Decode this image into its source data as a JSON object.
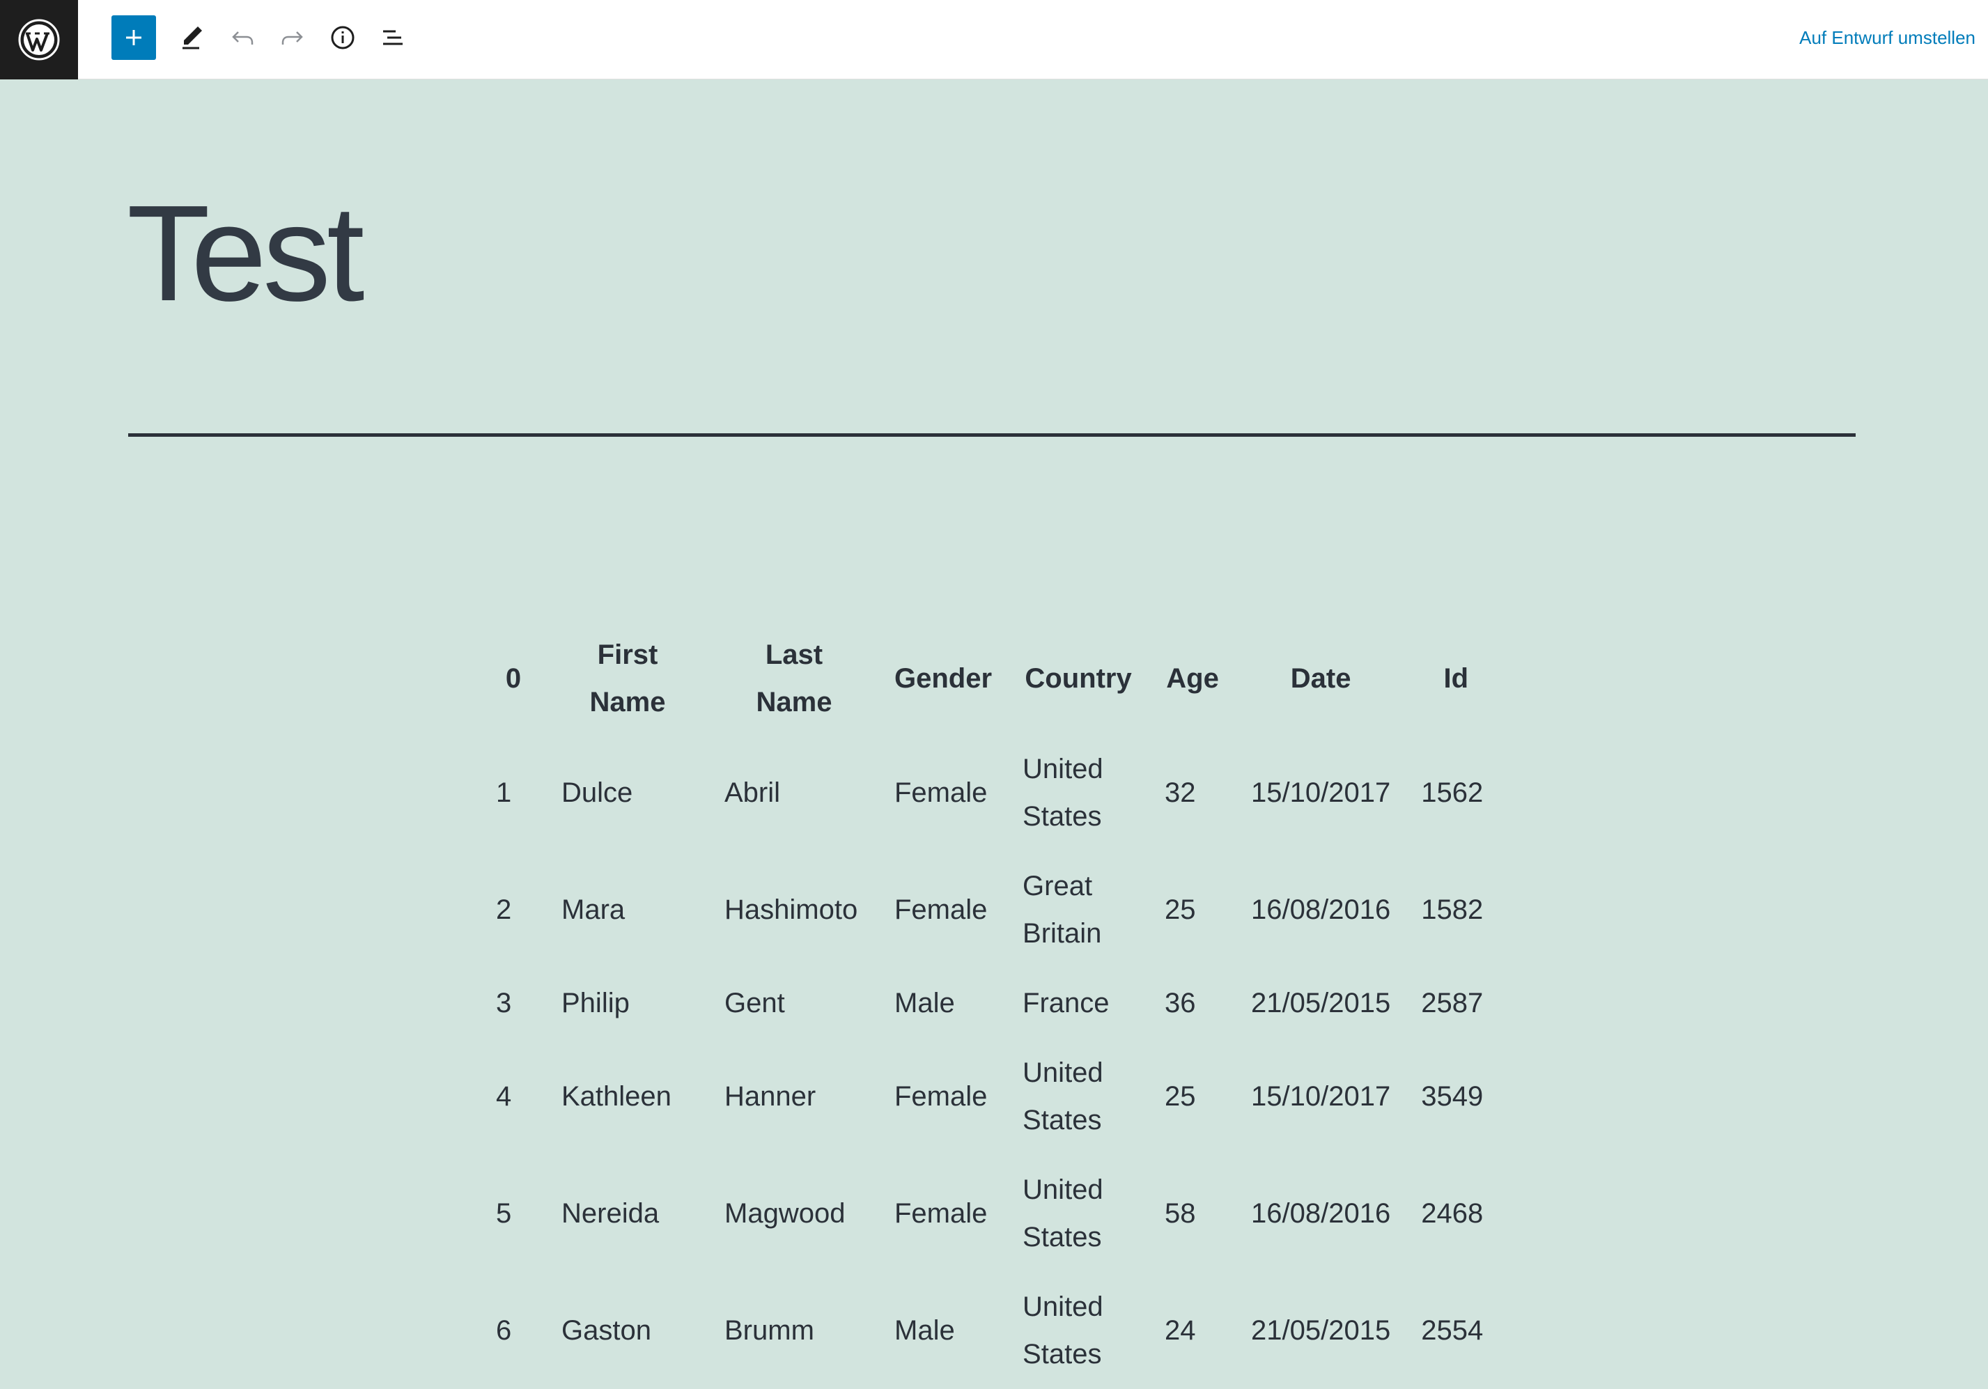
{
  "toolbar": {
    "logo_icon": "wordpress-icon",
    "add_icon": "plus-icon",
    "edit_icon": "pencil-icon",
    "undo_icon": "undo-icon",
    "redo_icon": "redo-icon",
    "info_icon": "info-icon",
    "outline_icon": "list-view-icon",
    "draft_label": "Auf Entwurf umstellen",
    "accent_color": "#007cba"
  },
  "post": {
    "title": "Test",
    "background_color": "#d2e4de"
  },
  "table": {
    "headers": [
      "0",
      "First Name",
      "Last Name",
      "Gender",
      "Country",
      "Age",
      "Date",
      "Id"
    ],
    "rows": [
      [
        "1",
        "Dulce",
        "Abril",
        "Female",
        "United States",
        "32",
        "15/10/2017",
        "1562"
      ],
      [
        "2",
        "Mara",
        "Hashimoto",
        "Female",
        "Great Britain",
        "25",
        "16/08/2016",
        "1582"
      ],
      [
        "3",
        "Philip",
        "Gent",
        "Male",
        "France",
        "36",
        "21/05/2015",
        "2587"
      ],
      [
        "4",
        "Kathleen",
        "Hanner",
        "Female",
        "United States",
        "25",
        "15/10/2017",
        "3549"
      ],
      [
        "5",
        "Nereida",
        "Magwood",
        "Female",
        "United States",
        "58",
        "16/08/2016",
        "2468"
      ],
      [
        "6",
        "Gaston",
        "Brumm",
        "Male",
        "United States",
        "24",
        "21/05/2015",
        "2554"
      ]
    ]
  }
}
